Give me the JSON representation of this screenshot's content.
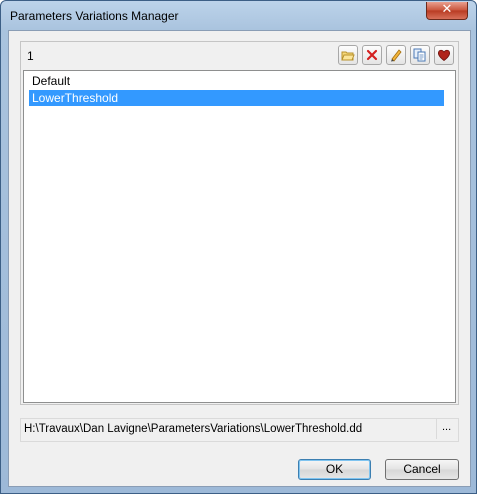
{
  "window": {
    "title": "Parameters Variations Manager",
    "close_glyph": "✕"
  },
  "header": {
    "variant_count": "1"
  },
  "toolbar": {
    "icons": [
      "open-folder-icon",
      "delete-icon",
      "edit-pencil-icon",
      "copy-icon",
      "favorite-heart-icon"
    ]
  },
  "list": {
    "items": [
      {
        "label": "Default",
        "selected": false
      },
      {
        "label": "LowerThreshold",
        "selected": true
      }
    ]
  },
  "path": {
    "value": "H:\\Travaux\\Dan Lavigne\\ParametersVariations\\LowerThreshold.dd",
    "browse_label": "..."
  },
  "buttons": {
    "ok": "OK",
    "cancel": "Cancel"
  },
  "colors": {
    "selection": "#3399ff",
    "close_button": "#c9533a"
  }
}
